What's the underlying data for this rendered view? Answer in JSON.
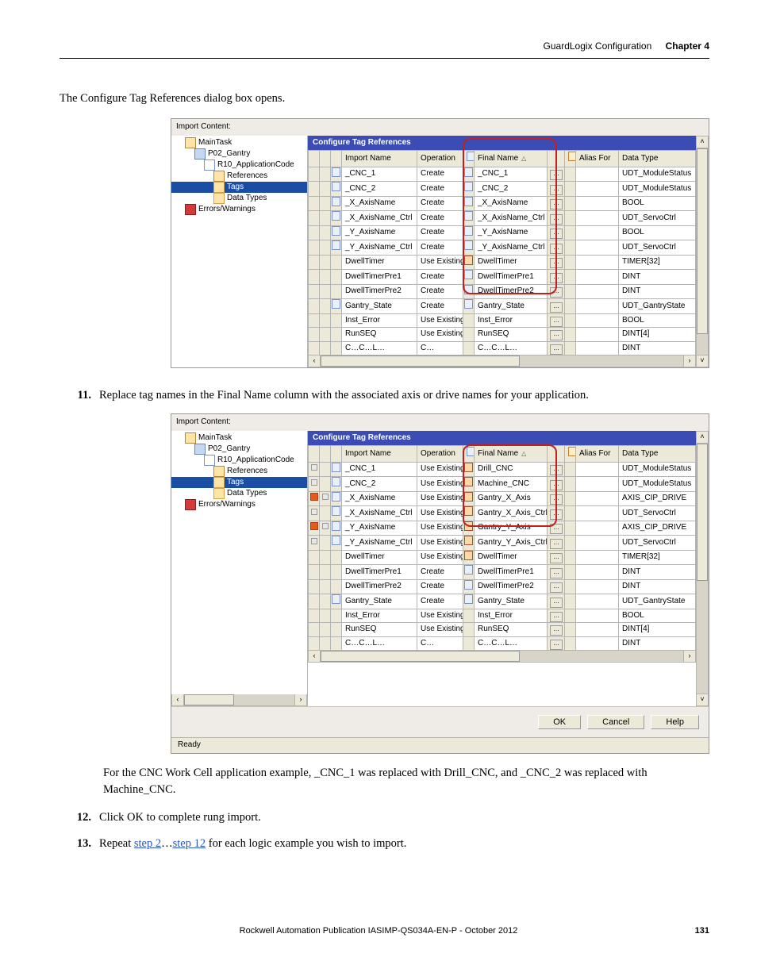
{
  "header": {
    "section": "GuardLogix Configuration",
    "chapter": "Chapter 4"
  },
  "intro": "The Configure Tag References dialog box opens.",
  "panel": {
    "import_label": "Import Content:",
    "config_title": "Configure Tag References",
    "tree": {
      "maintask": "MainTask",
      "prog": "P02_Gantry",
      "appcode": "R10_ApplicationCode",
      "refs": "References",
      "tags": "Tags",
      "dtypes": "Data Types",
      "errs": "Errors/Warnings"
    },
    "columns": {
      "import_name": "Import Name",
      "operation": "Operation",
      "final_name": "Final Name",
      "alias_for": "Alias For",
      "data_type": "Data Type"
    }
  },
  "shot1_rows": [
    {
      "im": "_CNC_1",
      "op": "Create",
      "fn": "_CNC_1",
      "dt": "UDT_ModuleStatus",
      "ic": "doc",
      "fic": "doc"
    },
    {
      "im": "_CNC_2",
      "op": "Create",
      "fn": "_CNC_2",
      "dt": "UDT_ModuleStatus",
      "ic": "doc",
      "fic": "doc"
    },
    {
      "im": "_X_AxisName",
      "op": "Create",
      "fn": "_X_AxisName",
      "dt": "BOOL",
      "ic": "doc",
      "fic": "doc"
    },
    {
      "im": "_X_AxisName_Ctrl",
      "op": "Create",
      "fn": "_X_AxisName_Ctrl",
      "dt": "UDT_ServoCtrl",
      "ic": "doc",
      "fic": "doc"
    },
    {
      "im": "_Y_AxisName",
      "op": "Create",
      "fn": "_Y_AxisName",
      "dt": "BOOL",
      "ic": "doc",
      "fic": "doc"
    },
    {
      "im": "_Y_AxisName_Ctrl",
      "op": "Create",
      "fn": "_Y_AxisName_Ctrl",
      "dt": "UDT_ServoCtrl",
      "ic": "doc",
      "fic": "doc"
    },
    {
      "im": "DwellTimer",
      "op": "Use Existing",
      "fn": "DwellTimer",
      "dt": "TIMER[32]",
      "ic": "",
      "fic": "star"
    },
    {
      "im": "DwellTimerPre1",
      "op": "Create",
      "fn": "DwellTimerPre1",
      "dt": "DINT",
      "ic": "",
      "fic": "doc"
    },
    {
      "im": "DwellTimerPre2",
      "op": "Create",
      "fn": "DwellTimerPre2",
      "dt": "DINT",
      "ic": "",
      "fic": "doc"
    },
    {
      "im": "Gantry_State",
      "op": "Create",
      "fn": "Gantry_State",
      "dt": "UDT_GantryState",
      "ic": "doc",
      "fic": "doc"
    },
    {
      "im": "Inst_Error",
      "op": "Use Existing",
      "fn": "Inst_Error",
      "dt": "BOOL",
      "ic": "",
      "fic": ""
    },
    {
      "im": "RunSEQ",
      "op": "Use Existing",
      "fn": "RunSEQ",
      "dt": "DINT[4]",
      "ic": "",
      "fic": ""
    },
    {
      "im": "C…C…L…",
      "op": "C…",
      "fn": "C…C…L…",
      "dt": "DINT",
      "ic": "",
      "fic": ""
    }
  ],
  "shot2_rows": [
    {
      "im": "_CNC_1",
      "op": "Use Existing",
      "fn": "Drill_CNC",
      "dt": "UDT_ModuleStatus",
      "ic": "doc",
      "fic": "star",
      "flag": "x"
    },
    {
      "im": "_CNC_2",
      "op": "Use Existing",
      "fn": "Machine_CNC",
      "dt": "UDT_ModuleStatus",
      "ic": "doc",
      "fic": "star",
      "flag": "x"
    },
    {
      "im": "_X_AxisName",
      "op": "Use Existing",
      "fn": "Gantry_X_Axis",
      "dt": "AXIS_CIP_DRIVE",
      "ic": "doc",
      "fic": "star",
      "flag": "warn"
    },
    {
      "im": "_X_AxisName_Ctrl",
      "op": "Use Existing",
      "fn": "Gantry_X_Axis_Ctrl",
      "dt": "UDT_ServoCtrl",
      "ic": "doc",
      "fic": "star",
      "flag": "x"
    },
    {
      "im": "_Y_AxisName",
      "op": "Use Existing",
      "fn": "Gantry_Y_Axis",
      "dt": "AXIS_CIP_DRIVE",
      "ic": "doc",
      "fic": "star",
      "flag": "warn"
    },
    {
      "im": "_Y_AxisName_Ctrl",
      "op": "Use Existing",
      "fn": "Gantry_Y_Axis_Ctrl",
      "dt": "UDT_ServoCtrl",
      "ic": "doc",
      "fic": "star",
      "flag": "x"
    },
    {
      "im": "DwellTimer",
      "op": "Use Existing",
      "fn": "DwellTimer",
      "dt": "TIMER[32]",
      "ic": "",
      "fic": "star"
    },
    {
      "im": "DwellTimerPre1",
      "op": "Create",
      "fn": "DwellTimerPre1",
      "dt": "DINT",
      "ic": "",
      "fic": "doc"
    },
    {
      "im": "DwellTimerPre2",
      "op": "Create",
      "fn": "DwellTimerPre2",
      "dt": "DINT",
      "ic": "",
      "fic": "doc"
    },
    {
      "im": "Gantry_State",
      "op": "Create",
      "fn": "Gantry_State",
      "dt": "UDT_GantryState",
      "ic": "doc",
      "fic": "doc"
    },
    {
      "im": "Inst_Error",
      "op": "Use Existing",
      "fn": "Inst_Error",
      "dt": "BOOL",
      "ic": "",
      "fic": ""
    },
    {
      "im": "RunSEQ",
      "op": "Use Existing",
      "fn": "RunSEQ",
      "dt": "DINT[4]",
      "ic": "",
      "fic": ""
    },
    {
      "im": "C…C…L…",
      "op": "C…",
      "fn": "C…C…L…",
      "dt": "DINT",
      "ic": "",
      "fic": ""
    }
  ],
  "steps": {
    "s11": "Replace tag names in the Final Name column with the associated axis or drive names for your application.",
    "s11_note": "For the CNC Work Cell application example, _CNC_1 was replaced with Drill_CNC, and _CNC_2 was replaced with Machine_CNC.",
    "s12": "Click OK to complete rung import.",
    "s13_a": "Repeat ",
    "s13_link1": "step 2",
    "s13_mid": "…",
    "s13_link2": "step 12",
    "s13_b": " for each logic example you wish to import."
  },
  "buttons": {
    "ok": "OK",
    "cancel": "Cancel",
    "help": "Help"
  },
  "status": "Ready",
  "footer": {
    "pub": "Rockwell Automation Publication IASIMP-QS034A-EN-P - ",
    "date": "October 2012",
    "page": "131"
  }
}
